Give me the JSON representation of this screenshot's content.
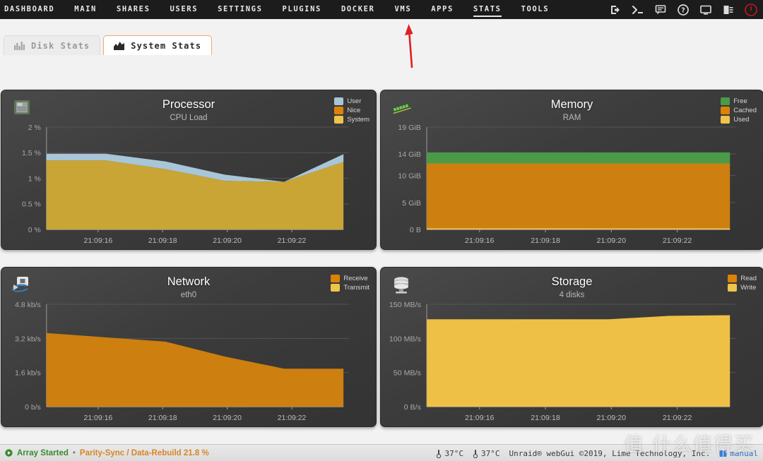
{
  "nav": {
    "items": [
      {
        "label": "DASHBOARD",
        "active": false
      },
      {
        "label": "MAIN",
        "active": false
      },
      {
        "label": "SHARES",
        "active": false
      },
      {
        "label": "USERS",
        "active": false
      },
      {
        "label": "SETTINGS",
        "active": false
      },
      {
        "label": "PLUGINS",
        "active": false
      },
      {
        "label": "DOCKER",
        "active": false
      },
      {
        "label": "VMS",
        "active": false
      },
      {
        "label": "APPS",
        "active": false
      },
      {
        "label": "STATS",
        "active": true
      },
      {
        "label": "TOOLS",
        "active": false
      }
    ],
    "icons": [
      {
        "name": "logout-icon"
      },
      {
        "name": "terminal-icon"
      },
      {
        "name": "chat-icon"
      },
      {
        "name": "help-icon"
      },
      {
        "name": "display-icon"
      },
      {
        "name": "log-icon"
      },
      {
        "name": "power-icon"
      }
    ]
  },
  "tabs": [
    {
      "label": "Disk Stats",
      "icon": "bar-chart-icon",
      "active": false
    },
    {
      "label": "System Stats",
      "icon": "area-chart-icon",
      "active": true
    }
  ],
  "annotation": {
    "type": "red-arrow",
    "points_to": "STATS",
    "color": "#e02020"
  },
  "panels": [
    {
      "title": "Processor",
      "subtitle": "CPU Load",
      "icon": "cpu-chip-icon",
      "legend": [
        {
          "label": "User",
          "color": "#a8c6d8"
        },
        {
          "label": "Nice",
          "color": "#dd8208"
        },
        {
          "label": "System",
          "color": "#f0c34a"
        }
      ]
    },
    {
      "title": "Memory",
      "subtitle": "RAM",
      "icon": "ram-stick-icon",
      "legend": [
        {
          "label": "Free",
          "color": "#4a9a48"
        },
        {
          "label": "Cached",
          "color": "#dd8208"
        },
        {
          "label": "Used",
          "color": "#f0c34a"
        }
      ]
    },
    {
      "title": "Network",
      "subtitle": "eth0",
      "icon": "network-icon",
      "legend": [
        {
          "label": "Receive",
          "color": "#dd8208"
        },
        {
          "label": "Transmit",
          "color": "#f0c34a"
        }
      ]
    },
    {
      "title": "Storage",
      "subtitle": "4 disks",
      "icon": "disks-icon",
      "legend": [
        {
          "label": "Read",
          "color": "#dd8208"
        },
        {
          "label": "Write",
          "color": "#f0c34a"
        }
      ]
    }
  ],
  "chart_data": [
    {
      "type": "area",
      "title": "Processor",
      "subtitle": "CPU Load",
      "xlabel": "",
      "ylabel": "%",
      "stacked": true,
      "grid": true,
      "legend_position": "top-right",
      "x": [
        "21:09:16",
        "21:09:18",
        "21:09:20",
        "21:09:22"
      ],
      "xtick_labels": [
        "21:09:16",
        "21:09:18",
        "21:09:20",
        "21:09:22"
      ],
      "ytick_labels": [
        "0 %",
        "0.5 %",
        "1 %",
        "1.5 %",
        "2 %"
      ],
      "ytick_values": [
        0,
        0.5,
        1,
        1.5,
        2
      ],
      "ylim": [
        0,
        2
      ],
      "series": [
        {
          "name": "System",
          "color": "#c9a536",
          "values": [
            1.35,
            1.35,
            1.18,
            0.95,
            0.93,
            1.32
          ]
        },
        {
          "name": "Nice",
          "color": "#dd8208",
          "values": [
            0,
            0,
            0,
            0,
            0,
            0
          ]
        },
        {
          "name": "User",
          "color": "#a8c6d8",
          "values": [
            0.13,
            0.13,
            0.15,
            0.12,
            0.0,
            0.15
          ]
        }
      ]
    },
    {
      "type": "area",
      "title": "Memory",
      "subtitle": "RAM",
      "xlabel": "",
      "ylabel": "GiB",
      "stacked": true,
      "grid": true,
      "legend_position": "top-right",
      "x": [
        "21:09:16",
        "21:09:18",
        "21:09:20",
        "21:09:22"
      ],
      "xtick_labels": [
        "21:09:16",
        "21:09:18",
        "21:09:20",
        "21:09:22"
      ],
      "ytick_labels": [
        "0 B",
        "5 GiB",
        "10 GiB",
        "14 GiB",
        "19 GiB"
      ],
      "ytick_values": [
        0,
        5,
        10,
        14,
        19
      ],
      "ylim": [
        0,
        19
      ],
      "series": [
        {
          "name": "Used",
          "color": "#f0c34a",
          "values": [
            0.25,
            0.25,
            0.25,
            0.25,
            0.25,
            0.25
          ]
        },
        {
          "name": "Cached",
          "color": "#cd7f10",
          "values": [
            12.0,
            12.0,
            12.0,
            12.0,
            12.0,
            12.0
          ]
        },
        {
          "name": "Free",
          "color": "#4a9a48",
          "values": [
            2.05,
            2.05,
            2.05,
            2.05,
            2.05,
            2.05
          ]
        }
      ]
    },
    {
      "type": "area",
      "title": "Network",
      "subtitle": "eth0",
      "xlabel": "",
      "ylabel": "kb/s",
      "stacked": true,
      "grid": true,
      "legend_position": "top-right",
      "x": [
        "21:09:16",
        "21:09:18",
        "21:09:20",
        "21:09:22"
      ],
      "xtick_labels": [
        "21:09:16",
        "21:09:18",
        "21:09:20",
        "21:09:22"
      ],
      "ytick_labels": [
        "0 b/s",
        "1.6 kb/s",
        "3.2 kb/s",
        "4.8 kb/s"
      ],
      "ytick_values": [
        0,
        1.6,
        3.2,
        4.8
      ],
      "ylim": [
        0,
        4.8
      ],
      "series": [
        {
          "name": "Receive",
          "color": "#cd7f10",
          "values": [
            3.45,
            3.25,
            3.05,
            2.35,
            1.78,
            1.78
          ]
        },
        {
          "name": "Transmit",
          "color": "#f0c34a",
          "values": [
            0,
            0,
            0,
            0,
            0,
            0
          ]
        }
      ]
    },
    {
      "type": "area",
      "title": "Storage",
      "subtitle": "4 disks",
      "xlabel": "",
      "ylabel": "MB/s",
      "stacked": true,
      "grid": true,
      "legend_position": "top-right",
      "x": [
        "21:09:16",
        "21:09:18",
        "21:09:20",
        "21:09:22"
      ],
      "xtick_labels": [
        "21:09:16",
        "21:09:18",
        "21:09:20",
        "21:09:22"
      ],
      "ytick_labels": [
        "0 B/s",
        "50 MB/s",
        "100 MB/s",
        "150 MB/s"
      ],
      "ytick_values": [
        0,
        50,
        100,
        150
      ],
      "ylim": [
        0,
        150
      ],
      "series": [
        {
          "name": "Read",
          "color": "#dd8208",
          "values": [
            0,
            0,
            0,
            0,
            0,
            0
          ]
        },
        {
          "name": "Write",
          "color": "#eec045",
          "values": [
            128,
            128,
            128,
            128,
            133,
            134
          ]
        }
      ]
    }
  ],
  "footer": {
    "array_status": "Array Started",
    "separator": "•",
    "parity_status": "Parity-Sync / Data-Rebuild 21.8 %",
    "temps": [
      "37°C",
      "37°C"
    ],
    "credit": "Unraid® webGui ©2019, Lime Technology, Inc.",
    "manual_link": "manual"
  },
  "watermark": "值 什么值得买"
}
